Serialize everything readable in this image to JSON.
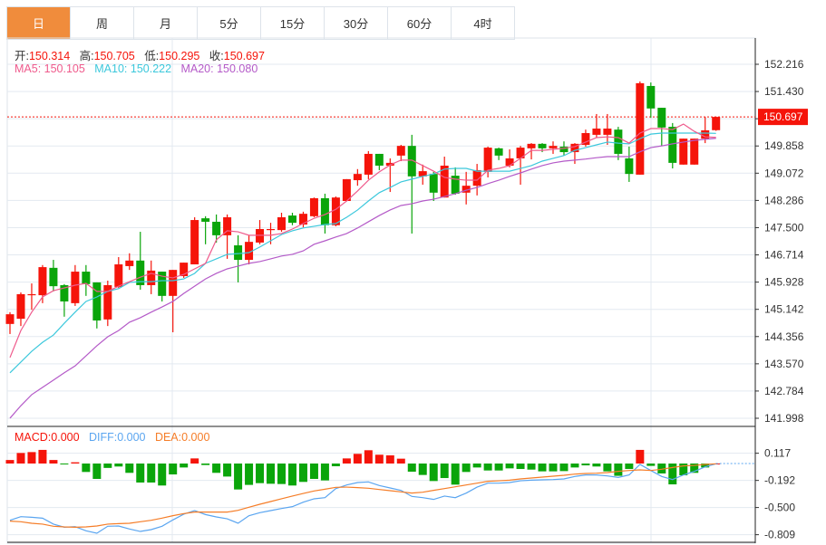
{
  "tabs": [
    "日",
    "周",
    "月",
    "5分",
    "15分",
    "30分",
    "60分",
    "4时"
  ],
  "active_tab": 0,
  "ohlc_info": {
    "open_label": "开:",
    "open": "150.314",
    "high_label": "高:",
    "high": "150.705",
    "low_label": "低:",
    "low": "150.295",
    "close_label": "收:",
    "close": "150.697"
  },
  "ma_info": {
    "ma5": "MA5: 150.105",
    "ma10": "MA10: 150.222",
    "ma20": "MA20: 150.080"
  },
  "macd_info": {
    "macd": "MACD:0.000",
    "diff": "DIFF:0.000",
    "dea": "DEA:0.000"
  },
  "colors": {
    "up": "#f5140a",
    "down": "#0aa50a",
    "ma5": "#ef5a8c",
    "ma10": "#3cc8dc",
    "ma20": "#b45ac8",
    "diff": "#5aa5f0",
    "dea": "#f57d28",
    "active_tab": "#f08c3c"
  },
  "chart_data": [
    {
      "type": "candlestick",
      "title": "",
      "y_ticks": [
        "152.216",
        "151.430",
        "150.644",
        "149.858",
        "149.072",
        "148.286",
        "147.500",
        "146.714",
        "145.928",
        "145.142",
        "144.356",
        "143.570",
        "142.784",
        "141.998"
      ],
      "ylim": [
        141.998,
        152.216
      ],
      "current_price": "150.697",
      "candles": [
        [
          144.72,
          145.06,
          144.43,
          145.0
        ],
        [
          144.87,
          145.63,
          144.66,
          145.58
        ],
        [
          145.55,
          145.89,
          145.13,
          145.58
        ],
        [
          145.55,
          146.42,
          145.32,
          146.36
        ],
        [
          146.34,
          146.57,
          145.66,
          145.81
        ],
        [
          145.84,
          145.87,
          144.93,
          145.37
        ],
        [
          145.32,
          146.42,
          145.24,
          146.23
        ],
        [
          146.23,
          146.42,
          145.53,
          145.87
        ],
        [
          145.92,
          145.92,
          144.59,
          144.82
        ],
        [
          144.85,
          145.97,
          144.66,
          145.84
        ],
        [
          145.79,
          146.65,
          145.76,
          146.44
        ],
        [
          146.39,
          146.76,
          146.28,
          146.55
        ],
        [
          146.55,
          147.38,
          145.71,
          145.84
        ],
        [
          145.84,
          146.55,
          145.58,
          146.26
        ],
        [
          146.23,
          146.23,
          145.37,
          145.53
        ],
        [
          145.53,
          146.28,
          144.48,
          146.28
        ],
        [
          146.1,
          146.49,
          146.05,
          146.49
        ],
        [
          146.44,
          147.8,
          146.44,
          147.72
        ],
        [
          147.77,
          147.83,
          147.02,
          147.67
        ],
        [
          147.67,
          147.88,
          147.07,
          147.28
        ],
        [
          147.28,
          147.88,
          146.6,
          147.8
        ],
        [
          146.99,
          147.28,
          145.92,
          146.57
        ],
        [
          146.57,
          147.28,
          146.44,
          147.09
        ],
        [
          147.07,
          147.72,
          147.02,
          147.46
        ],
        [
          147.43,
          147.64,
          147.02,
          147.46
        ],
        [
          147.43,
          147.93,
          147.38,
          147.8
        ],
        [
          147.85,
          147.93,
          147.57,
          147.64
        ],
        [
          147.59,
          147.96,
          147.51,
          147.9
        ],
        [
          147.83,
          148.37,
          147.8,
          148.35
        ],
        [
          148.35,
          148.48,
          147.33,
          147.57
        ],
        [
          147.57,
          148.4,
          147.54,
          148.37
        ],
        [
          148.27,
          148.9,
          148.27,
          148.9
        ],
        [
          148.87,
          149.19,
          148.71,
          149.05
        ],
        [
          149.03,
          149.71,
          148.9,
          149.63
        ],
        [
          149.63,
          149.63,
          149.16,
          149.29
        ],
        [
          149.29,
          149.5,
          148.53,
          149.37
        ],
        [
          149.58,
          149.89,
          149.42,
          149.86
        ],
        [
          149.86,
          150.18,
          147.33,
          148.98
        ],
        [
          148.98,
          149.32,
          148.74,
          149.13
        ],
        [
          149.05,
          149.11,
          148.27,
          148.51
        ],
        [
          148.37,
          149.55,
          148.37,
          149.29
        ],
        [
          149.0,
          149.24,
          148.45,
          148.48
        ],
        [
          148.51,
          149.11,
          148.17,
          148.71
        ],
        [
          148.71,
          149.34,
          148.43,
          149.16
        ],
        [
          149.11,
          149.84,
          148.95,
          149.81
        ],
        [
          149.79,
          149.81,
          149.45,
          149.58
        ],
        [
          149.29,
          149.76,
          149.24,
          149.5
        ],
        [
          149.5,
          149.86,
          148.74,
          149.81
        ],
        [
          149.79,
          149.94,
          149.47,
          149.92
        ],
        [
          149.92,
          149.94,
          149.68,
          149.79
        ],
        [
          149.79,
          149.99,
          149.63,
          149.86
        ],
        [
          149.84,
          149.99,
          149.58,
          149.68
        ],
        [
          149.68,
          149.94,
          149.34,
          149.92
        ],
        [
          149.89,
          150.33,
          149.84,
          150.23
        ],
        [
          150.18,
          150.78,
          150.1,
          150.36
        ],
        [
          150.18,
          150.78,
          149.89,
          150.36
        ],
        [
          150.33,
          150.41,
          149.45,
          149.63
        ],
        [
          149.5,
          149.84,
          148.82,
          149.05
        ],
        [
          149.03,
          151.72,
          149.03,
          151.67
        ],
        [
          151.59,
          151.69,
          150.67,
          150.94
        ],
        [
          150.96,
          150.96,
          149.86,
          150.39
        ],
        [
          150.41,
          150.52,
          149.21,
          149.37
        ],
        [
          149.32,
          150.07,
          149.32,
          150.07
        ],
        [
          149.32,
          150.07,
          149.32,
          150.07
        ],
        [
          150.07,
          150.7,
          149.94,
          150.31
        ],
        [
          150.314,
          150.705,
          150.295,
          150.697
        ]
      ],
      "ma5": [
        143.75,
        144.53,
        145.06,
        145.5,
        145.68,
        145.76,
        145.84,
        145.89,
        145.66,
        145.66,
        145.81,
        145.94,
        146.07,
        146.18,
        146.1,
        146.05,
        146.15,
        146.31,
        146.47,
        147.15,
        147.41,
        147.38,
        147.28,
        147.28,
        147.28,
        147.33,
        147.46,
        147.62,
        147.77,
        147.88,
        148.03,
        148.27,
        148.56,
        148.87,
        149.11,
        149.31,
        149.45,
        149.45,
        149.29,
        149.13,
        148.95,
        148.9,
        148.87,
        148.87,
        149.16,
        149.21,
        149.29,
        149.5,
        149.73,
        149.73,
        149.76,
        149.79,
        149.84,
        149.97,
        150.1,
        150.12,
        150.1,
        149.94,
        150.23,
        150.36,
        150.36,
        150.33,
        150.49,
        150.28,
        150.12,
        150.105
      ],
      "ma10": [
        143.31,
        143.62,
        143.93,
        144.19,
        144.4,
        144.74,
        145.06,
        145.37,
        145.5,
        145.66,
        145.74,
        145.92,
        145.94,
        145.94,
        145.97,
        145.97,
        146.02,
        146.18,
        146.47,
        146.6,
        146.73,
        146.75,
        146.78,
        146.94,
        147.12,
        147.3,
        147.41,
        147.49,
        147.54,
        147.59,
        147.62,
        147.8,
        148.01,
        148.27,
        148.51,
        148.66,
        148.82,
        148.9,
        148.98,
        149.05,
        149.19,
        149.21,
        149.21,
        149.13,
        149.13,
        149.13,
        149.13,
        149.21,
        149.29,
        149.42,
        149.5,
        149.58,
        149.73,
        149.81,
        149.89,
        149.97,
        149.94,
        149.92,
        150.07,
        150.2,
        150.23,
        150.23,
        150.23,
        150.23,
        150.23,
        150.222
      ],
      "ma20": [
        142.0,
        142.36,
        142.68,
        142.89,
        143.1,
        143.31,
        143.51,
        143.8,
        144.09,
        144.35,
        144.53,
        144.77,
        144.9,
        145.06,
        145.21,
        145.37,
        145.6,
        145.81,
        146.02,
        146.18,
        146.31,
        146.39,
        146.47,
        146.52,
        146.6,
        146.68,
        146.73,
        146.83,
        147.02,
        147.12,
        147.23,
        147.33,
        147.49,
        147.67,
        147.85,
        148.01,
        148.14,
        148.19,
        148.27,
        148.32,
        148.4,
        148.48,
        148.58,
        148.66,
        148.77,
        148.87,
        148.98,
        149.08,
        149.19,
        149.29,
        149.37,
        149.42,
        149.45,
        149.48,
        149.52,
        149.55,
        149.55,
        149.55,
        149.69,
        149.81,
        149.86,
        149.92,
        149.97,
        150.02,
        150.05,
        150.08
      ]
    },
    {
      "type": "bar+line",
      "title": "MACD",
      "y_ticks": [
        "0.117",
        "-0.192",
        "-0.500",
        "-0.809"
      ],
      "ylim": [
        -0.85,
        0.17
      ],
      "macd": [
        0.04,
        0.12,
        0.13,
        0.155,
        0.04,
        -0.01,
        0.014,
        -0.096,
        -0.175,
        -0.05,
        -0.034,
        -0.106,
        -0.216,
        -0.216,
        -0.25,
        -0.124,
        -0.045,
        0.058,
        -0.017,
        -0.106,
        -0.148,
        -0.295,
        -0.243,
        -0.223,
        -0.23,
        -0.233,
        -0.25,
        -0.209,
        -0.175,
        -0.192,
        -0.031,
        0.058,
        0.11,
        0.151,
        0.1,
        0.093,
        0.055,
        -0.093,
        -0.13,
        -0.199,
        -0.165,
        -0.24,
        -0.096,
        -0.045,
        -0.079,
        -0.079,
        -0.055,
        -0.062,
        -0.069,
        -0.089,
        -0.089,
        -0.086,
        -0.045,
        -0.021,
        -0.034,
        -0.089,
        -0.14,
        -0.062,
        0.155,
        -0.027,
        -0.113,
        -0.237,
        -0.134,
        -0.106,
        -0.045,
        0.0
      ],
      "diff": [
        -0.645,
        -0.604,
        -0.611,
        -0.621,
        -0.689,
        -0.724,
        -0.717,
        -0.765,
        -0.792,
        -0.713,
        -0.71,
        -0.744,
        -0.772,
        -0.751,
        -0.713,
        -0.641,
        -0.576,
        -0.535,
        -0.58,
        -0.607,
        -0.628,
        -0.679,
        -0.593,
        -0.559,
        -0.535,
        -0.511,
        -0.49,
        -0.439,
        -0.401,
        -0.388,
        -0.285,
        -0.244,
        -0.216,
        -0.209,
        -0.25,
        -0.278,
        -0.305,
        -0.374,
        -0.388,
        -0.408,
        -0.37,
        -0.388,
        -0.336,
        -0.268,
        -0.223,
        -0.223,
        -0.216,
        -0.196,
        -0.189,
        -0.185,
        -0.182,
        -0.175,
        -0.147,
        -0.13,
        -0.13,
        -0.141,
        -0.158,
        -0.13,
        -0.01,
        -0.079,
        -0.147,
        -0.182,
        -0.13,
        -0.089,
        -0.038,
        -0.003
      ],
      "dea": [
        -0.655,
        -0.662,
        -0.679,
        -0.689,
        -0.713,
        -0.72,
        -0.724,
        -0.72,
        -0.71,
        -0.689,
        -0.683,
        -0.679,
        -0.662,
        -0.645,
        -0.621,
        -0.593,
        -0.569,
        -0.552,
        -0.552,
        -0.552,
        -0.552,
        -0.532,
        -0.497,
        -0.463,
        -0.432,
        -0.401,
        -0.37,
        -0.34,
        -0.312,
        -0.292,
        -0.271,
        -0.268,
        -0.274,
        -0.281,
        -0.295,
        -0.309,
        -0.322,
        -0.336,
        -0.326,
        -0.305,
        -0.285,
        -0.264,
        -0.244,
        -0.223,
        -0.202,
        -0.196,
        -0.189,
        -0.175,
        -0.165,
        -0.154,
        -0.144,
        -0.134,
        -0.12,
        -0.113,
        -0.11,
        -0.103,
        -0.089,
        -0.079,
        -0.072,
        -0.079,
        -0.065,
        -0.045,
        -0.027,
        -0.021,
        -0.01,
        -0.003
      ]
    }
  ]
}
